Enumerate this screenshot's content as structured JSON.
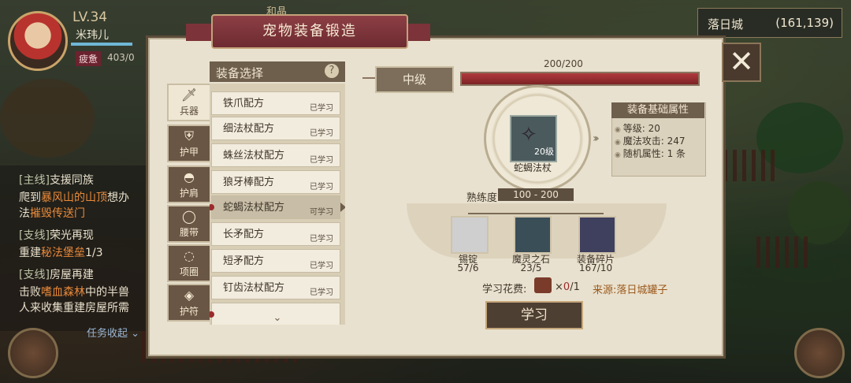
{
  "player": {
    "level": "LV.34",
    "name": "米玮儿",
    "fatigue_label": "疲惫",
    "fatigue_value": "403/0"
  },
  "top_hint": "和晶",
  "city": {
    "name": "落日城",
    "coords": "(161,139)"
  },
  "quests": [
    {
      "tag": "[主线]",
      "title": "支援同族"
    },
    {
      "line": "爬到",
      "hl": "暴风山的山顶",
      "tail": "想办"
    },
    {
      "line": "法",
      "hl": "摧毁传送门",
      "tail": ""
    },
    {
      "tag": "[支线]",
      "title": "荣光再现"
    },
    {
      "line": "重建",
      "hl": "秘法堡垒",
      "tail": "1/3"
    },
    {
      "tag": "[支线]",
      "title": "房屋再建"
    },
    {
      "line": "击败",
      "hl": "嗜血森林",
      "tail": "中的半兽"
    },
    {
      "line": "人来收集重建房屋所需",
      "hl": "",
      "tail": ""
    }
  ],
  "quest_collapse": "任务收起",
  "panel": {
    "title": "宠物装备锻造",
    "close": "✕"
  },
  "categories": [
    {
      "label": "兵器",
      "icon": "sword-icon",
      "glyph": "🗡"
    },
    {
      "label": "护甲",
      "icon": "armor-icon",
      "glyph": "⛨"
    },
    {
      "label": "护肩",
      "icon": "shoulder-icon",
      "glyph": "◓"
    },
    {
      "label": "腰带",
      "icon": "belt-icon",
      "glyph": "◯"
    },
    {
      "label": "项圈",
      "icon": "collar-icon",
      "glyph": "◌"
    },
    {
      "label": "护符",
      "icon": "amulet-icon",
      "glyph": "◈"
    }
  ],
  "recipe_list": {
    "header": "装备选择",
    "help": "?",
    "items": [
      {
        "name": "铁爪配方",
        "status": "已学习"
      },
      {
        "name": "细法杖配方",
        "status": "已学习"
      },
      {
        "name": "蛛丝法杖配方",
        "status": "已学习"
      },
      {
        "name": "狼牙棒配方",
        "status": "已学习"
      },
      {
        "name": "蛇蝎法杖配方",
        "status": "可学习"
      },
      {
        "name": "长矛配方",
        "status": "已学习"
      },
      {
        "name": "短矛配方",
        "status": "已学习"
      },
      {
        "name": "钉齿法杖配方",
        "status": "已学习"
      }
    ],
    "more": "⌄"
  },
  "tier": {
    "label": "中级",
    "progress": "200/200",
    "fraction": 1.0
  },
  "item": {
    "name": "蛇蝎法杖",
    "level_badge": "20级",
    "proficiency_label": "熟练度",
    "proficiency_range": "100 - 200"
  },
  "attributes": {
    "header": "装备基础属性",
    "rows": [
      "等级: 20",
      "魔法攻击: 247",
      "随机属性: 1 条"
    ]
  },
  "materials": [
    {
      "name": "锡锭",
      "count": "57/6",
      "color": "#cfcfcf",
      "icon": "tin-ingot-icon"
    },
    {
      "name": "魔灵之石",
      "count": "23/5",
      "color": "#3a4e58",
      "icon": "magic-stone-icon"
    },
    {
      "name": "装备碎片",
      "count": "167/10",
      "color": "#3f3f5e",
      "icon": "equip-shard-icon"
    }
  ],
  "cost": {
    "label": "学习花费:",
    "prefix": "×",
    "owned": "0",
    "need": "/1",
    "source": "来源:落日城罐子"
  },
  "learn_button": "学习"
}
